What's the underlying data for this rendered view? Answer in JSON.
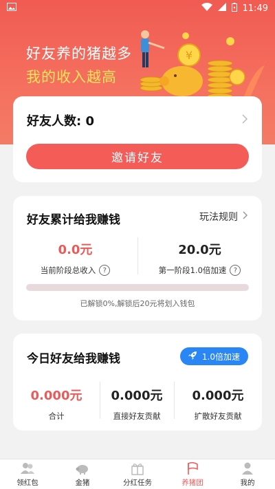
{
  "status_bar": {
    "time": "11:49"
  },
  "hero": {
    "line1": "好友养的猪越多",
    "line2": "我的收入越高"
  },
  "friends_card": {
    "label": "好友人数: 0",
    "invite_button": "邀请好友"
  },
  "earnings_card": {
    "title": "好友累计给我赚钱",
    "rules_link": "玩法规则",
    "current_income_value": "0.0元",
    "current_income_label": "当前阶段总收入",
    "stage_value": "20.0元",
    "stage_label": "第一阶段1.0倍加速",
    "progress_fraction": 0,
    "unlock_note": "已解锁0%,解锁后20元将划入钱包"
  },
  "today_card": {
    "title": "今日好友给我赚钱",
    "boost_badge": "1.0倍加速",
    "stats": [
      {
        "value": "0.000元",
        "label": "合计"
      },
      {
        "value": "0.000元",
        "label": "直接好友贡献"
      },
      {
        "value": "0.000元",
        "label": "扩散好友贡献"
      }
    ]
  },
  "tabs": [
    {
      "label": "领红包",
      "icon": "people-icon",
      "active": false
    },
    {
      "label": "金猪",
      "icon": "pig-icon",
      "active": false
    },
    {
      "label": "分红任务",
      "icon": "gift-icon",
      "active": false
    },
    {
      "label": "养猪团",
      "icon": "flag-icon",
      "active": true
    },
    {
      "label": "我的",
      "icon": "user-icon",
      "active": false
    }
  ],
  "colors": {
    "accent": "#f45c58",
    "hero_yellow": "#ffe45a",
    "badge_blue": "#2a86f4"
  }
}
